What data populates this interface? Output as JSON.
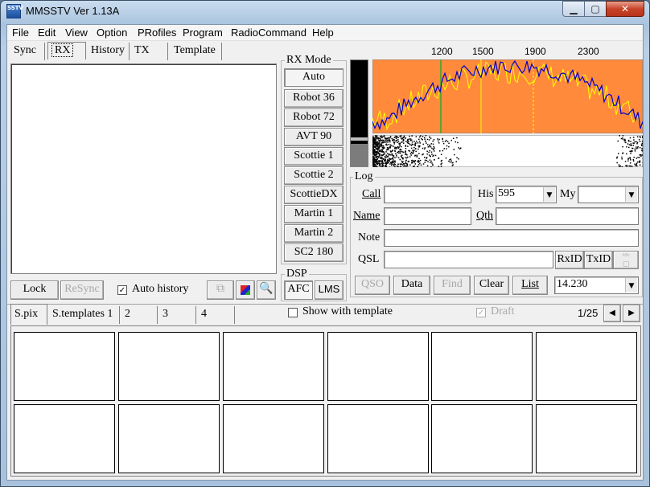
{
  "window": {
    "title": "MMSSTV Ver 1.13A",
    "icon_text": "SSTV"
  },
  "menu": [
    "File",
    "Edit",
    "View",
    "Option",
    "PRofiles",
    "Program",
    "RadioCommand",
    "Help"
  ],
  "tabs": [
    "Sync",
    "RX",
    "History",
    "TX",
    "Template"
  ],
  "rx_buttons": {
    "lock": "Lock",
    "resync": "ReSync",
    "auto_history": "Auto history"
  },
  "rx_mode": {
    "label": "RX Mode",
    "modes": [
      "Auto",
      "Robot 36",
      "Robot 72",
      "AVT 90",
      "Scottie 1",
      "Scottie 2",
      "ScottieDX",
      "Martin 1",
      "Martin 2",
      "SC2 180"
    ]
  },
  "dsp": {
    "label": "DSP",
    "afc": "AFC",
    "lms": "LMS"
  },
  "spectrum": {
    "ticks": [
      "1200",
      "1500",
      "1900",
      "2300"
    ],
    "bg_color": "#ff8a3c",
    "line1": "#0000cc",
    "line2": "#ffff00"
  },
  "log": {
    "label": "Log",
    "call": "Call",
    "his": "His",
    "his_value": "595",
    "my": "My",
    "name": "Name",
    "qth": "Qth",
    "note": "Note",
    "qsl": "QSL",
    "rxid": "RxID",
    "txid": "TxID",
    "qso": "QSO",
    "data": "Data",
    "find": "Find",
    "clear": "Clear",
    "list": "List",
    "freq": "14.230"
  },
  "bottom_tabs": [
    "S.pix",
    "S.templates 1",
    "2",
    "3",
    "4"
  ],
  "show_with_template": "Show with template",
  "draft": "Draft",
  "page_counter": "1/25"
}
